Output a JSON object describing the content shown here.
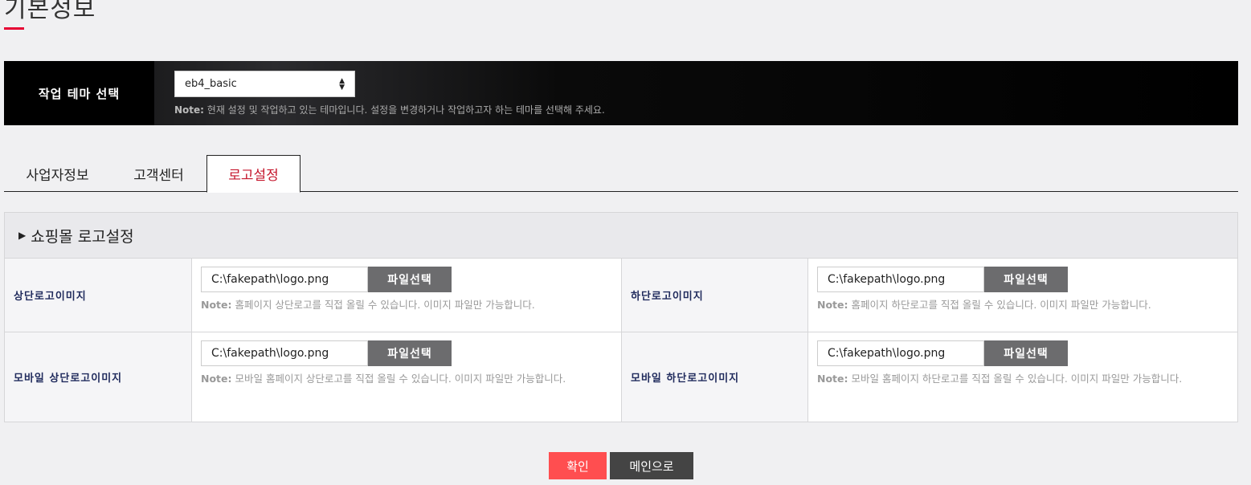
{
  "page": {
    "title": "기본정보"
  },
  "theme": {
    "label": "작업 테마 선택",
    "selected": "eb4_basic",
    "note_prefix": "Note:",
    "note_text": " 현재 설정 및 작업하고 있는 테마입니다. 설정을 변경하거나 작업하고자 하는 테마를 선택해 주세요."
  },
  "tabs": [
    {
      "label": "사업자정보",
      "active": false
    },
    {
      "label": "고객센터",
      "active": false
    },
    {
      "label": "로고설정",
      "active": true
    }
  ],
  "section": {
    "title": "쇼핑몰 로고설정"
  },
  "fields": {
    "top_logo": {
      "label": "상단로고이미지",
      "value": "C:\\fakepath\\logo.png",
      "button": "파일선택",
      "note_prefix": "Note:",
      "note_text": " 홈페이지 상단로고를 직접 올릴 수 있습니다. 이미지 파일만 가능합니다."
    },
    "bottom_logo": {
      "label": "하단로고이미지",
      "value": "C:\\fakepath\\logo.png",
      "button": "파일선택",
      "note_prefix": "Note:",
      "note_text": " 홈페이지 하단로고를 직접 올릴 수 있습니다. 이미지 파일만 가능합니다."
    },
    "mobile_top_logo": {
      "label": "모바일 상단로고이미지",
      "value": "C:\\fakepath\\logo.png",
      "button": "파일선택",
      "note_prefix": "Note:",
      "note_text": " 모바일 홈페이지 상단로고를 직접 올릴 수 있습니다. 이미지 파일만 가능합니다."
    },
    "mobile_bottom_logo": {
      "label": "모바일 하단로고이미지",
      "value": "C:\\fakepath\\logo.png",
      "button": "파일선택",
      "note_prefix": "Note:",
      "note_text": " 모바일 홈페이지 하단로고를 직접 올릴 수 있습니다. 이미지 파일만 가능합니다."
    }
  },
  "actions": {
    "confirm": "확인",
    "main": "메인으로"
  },
  "colors": {
    "accent": "#e60033",
    "confirm": "#ff4e50",
    "active_tab": "#c5162c",
    "label": "#1f2a5c"
  }
}
